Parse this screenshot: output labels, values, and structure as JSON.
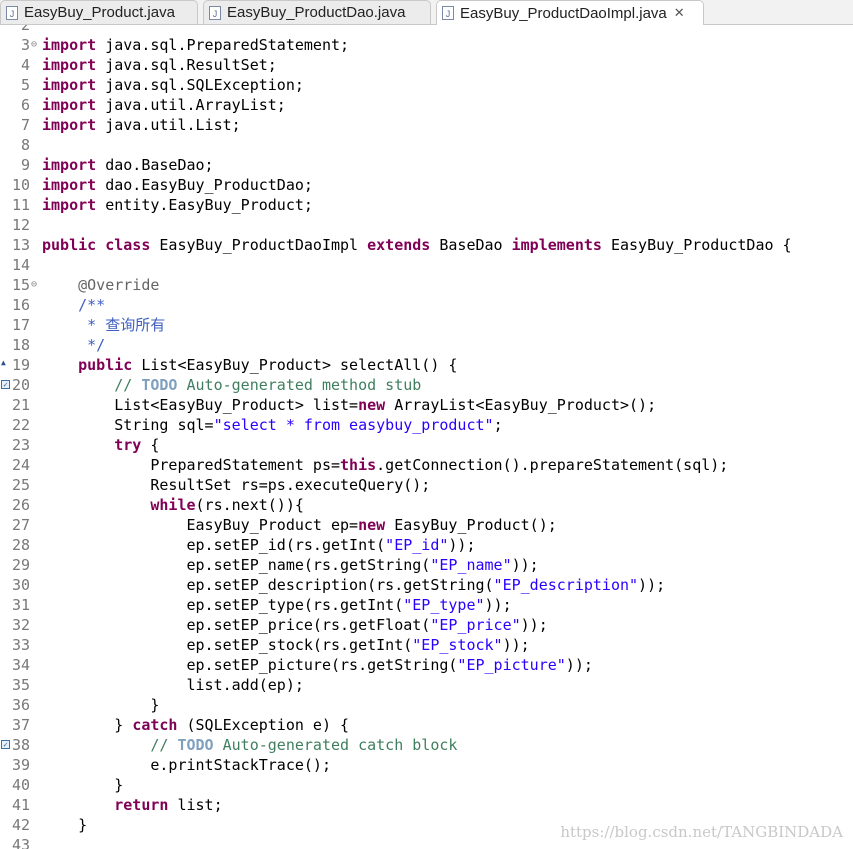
{
  "tabs": [
    {
      "label": "EasyBuy_Product.java",
      "active": false
    },
    {
      "label": "EasyBuy_ProductDao.java",
      "active": false
    },
    {
      "label": "EasyBuy_ProductDaoImpl.java",
      "active": true,
      "close": "✕"
    }
  ],
  "colors": {
    "keyword": "#7f0055",
    "string": "#2a00ff",
    "comment": "#3f7f5f",
    "javadoc": "#3f5fbf",
    "annotation": "#646464",
    "todo": "#7f9fbf"
  },
  "editor": {
    "lines": [
      {
        "n": "2",
        "tokens": []
      },
      {
        "n": "3",
        "fold": "⊖",
        "tokens": [
          {
            "t": "import",
            "k": "kw"
          },
          {
            "t": " java.sql.PreparedStatement;"
          }
        ]
      },
      {
        "n": "4",
        "tokens": [
          {
            "t": "import",
            "k": "kw"
          },
          {
            "t": " java.sql.ResultSet;"
          }
        ]
      },
      {
        "n": "5",
        "tokens": [
          {
            "t": "import",
            "k": "kw"
          },
          {
            "t": " java.sql.SQLException;"
          }
        ]
      },
      {
        "n": "6",
        "tokens": [
          {
            "t": "import",
            "k": "kw"
          },
          {
            "t": " java.util.ArrayList;"
          }
        ]
      },
      {
        "n": "7",
        "tokens": [
          {
            "t": "import",
            "k": "kw"
          },
          {
            "t": " java.util.List;"
          }
        ]
      },
      {
        "n": "8",
        "tokens": []
      },
      {
        "n": "9",
        "tokens": [
          {
            "t": "import",
            "k": "kw"
          },
          {
            "t": " dao.BaseDao;"
          }
        ]
      },
      {
        "n": "10",
        "tokens": [
          {
            "t": "import",
            "k": "kw"
          },
          {
            "t": " dao.EasyBuy_ProductDao;"
          }
        ]
      },
      {
        "n": "11",
        "tokens": [
          {
            "t": "import",
            "k": "kw"
          },
          {
            "t": " entity.EasyBuy_Product;"
          }
        ]
      },
      {
        "n": "12",
        "tokens": []
      },
      {
        "n": "13",
        "tokens": [
          {
            "t": "public",
            "k": "kw"
          },
          {
            "t": " "
          },
          {
            "t": "class",
            "k": "kw"
          },
          {
            "t": " EasyBuy_ProductDaoImpl "
          },
          {
            "t": "extends",
            "k": "kw"
          },
          {
            "t": " BaseDao "
          },
          {
            "t": "implements",
            "k": "kw"
          },
          {
            "t": " EasyBuy_ProductDao {"
          }
        ]
      },
      {
        "n": "14",
        "tokens": []
      },
      {
        "n": "15",
        "fold": "⊖",
        "tokens": [
          {
            "t": "    "
          },
          {
            "t": "@Override",
            "k": "ann"
          }
        ]
      },
      {
        "n": "16",
        "tokens": [
          {
            "t": "    "
          },
          {
            "t": "/**",
            "k": "doc"
          }
        ]
      },
      {
        "n": "17",
        "tokens": [
          {
            "t": "     "
          },
          {
            "t": "* 查询所有",
            "k": "doc"
          }
        ]
      },
      {
        "n": "18",
        "tokens": [
          {
            "t": "     "
          },
          {
            "t": "*/",
            "k": "doc"
          }
        ]
      },
      {
        "n": "19",
        "marker": "override",
        "tokens": [
          {
            "t": "    "
          },
          {
            "t": "public",
            "k": "kw"
          },
          {
            "t": " List<EasyBuy_Product> selectAll() {"
          }
        ]
      },
      {
        "n": "20",
        "marker": "task",
        "tokens": [
          {
            "t": "        "
          },
          {
            "t": "// ",
            "k": "cm"
          },
          {
            "t": "TODO",
            "k": "todo"
          },
          {
            "t": " Auto-generated method stub",
            "k": "cm"
          }
        ]
      },
      {
        "n": "21",
        "tokens": [
          {
            "t": "        List<EasyBuy_Product> list="
          },
          {
            "t": "new",
            "k": "kw"
          },
          {
            "t": " ArrayList<EasyBuy_Product>();"
          }
        ]
      },
      {
        "n": "22",
        "tokens": [
          {
            "t": "        String sql="
          },
          {
            "t": "\"select * from easybuy_product\"",
            "k": "str"
          },
          {
            "t": ";"
          }
        ]
      },
      {
        "n": "23",
        "tokens": [
          {
            "t": "        "
          },
          {
            "t": "try",
            "k": "kw"
          },
          {
            "t": " {"
          }
        ]
      },
      {
        "n": "24",
        "tokens": [
          {
            "t": "            PreparedStatement ps="
          },
          {
            "t": "this",
            "k": "kw"
          },
          {
            "t": ".getConnection().prepareStatement(sql);"
          }
        ]
      },
      {
        "n": "25",
        "tokens": [
          {
            "t": "            ResultSet rs=ps.executeQuery();"
          }
        ]
      },
      {
        "n": "26",
        "tokens": [
          {
            "t": "            "
          },
          {
            "t": "while",
            "k": "kw"
          },
          {
            "t": "(rs.next()){"
          }
        ]
      },
      {
        "n": "27",
        "tokens": [
          {
            "t": "                EasyBuy_Product ep="
          },
          {
            "t": "new",
            "k": "kw"
          },
          {
            "t": " EasyBuy_Product();"
          }
        ]
      },
      {
        "n": "28",
        "tokens": [
          {
            "t": "                ep.setEP_id(rs.getInt("
          },
          {
            "t": "\"EP_id\"",
            "k": "str"
          },
          {
            "t": "));"
          }
        ]
      },
      {
        "n": "29",
        "tokens": [
          {
            "t": "                ep.setEP_name(rs.getString("
          },
          {
            "t": "\"EP_name\"",
            "k": "str"
          },
          {
            "t": "));"
          }
        ]
      },
      {
        "n": "30",
        "tokens": [
          {
            "t": "                ep.setEP_description(rs.getString("
          },
          {
            "t": "\"EP_description\"",
            "k": "str"
          },
          {
            "t": "));"
          }
        ]
      },
      {
        "n": "31",
        "tokens": [
          {
            "t": "                ep.setEP_type(rs.getInt("
          },
          {
            "t": "\"EP_type\"",
            "k": "str"
          },
          {
            "t": "));"
          }
        ]
      },
      {
        "n": "32",
        "tokens": [
          {
            "t": "                ep.setEP_price(rs.getFloat("
          },
          {
            "t": "\"EP_price\"",
            "k": "str"
          },
          {
            "t": "));"
          }
        ]
      },
      {
        "n": "33",
        "tokens": [
          {
            "t": "                ep.setEP_stock(rs.getInt("
          },
          {
            "t": "\"EP_stock\"",
            "k": "str"
          },
          {
            "t": "));"
          }
        ]
      },
      {
        "n": "34",
        "tokens": [
          {
            "t": "                ep.setEP_picture(rs.getString("
          },
          {
            "t": "\"EP_picture\"",
            "k": "str"
          },
          {
            "t": "));"
          }
        ]
      },
      {
        "n": "35",
        "tokens": [
          {
            "t": "                list.add(ep);"
          }
        ]
      },
      {
        "n": "36",
        "tokens": [
          {
            "t": "            }"
          }
        ]
      },
      {
        "n": "37",
        "tokens": [
          {
            "t": "        } "
          },
          {
            "t": "catch",
            "k": "kw"
          },
          {
            "t": " (SQLException e) {"
          }
        ]
      },
      {
        "n": "38",
        "marker": "task",
        "tokens": [
          {
            "t": "            "
          },
          {
            "t": "// ",
            "k": "cm"
          },
          {
            "t": "TODO",
            "k": "todo"
          },
          {
            "t": " Auto-generated catch block",
            "k": "cm"
          }
        ]
      },
      {
        "n": "39",
        "tokens": [
          {
            "t": "            e.printStackTrace();"
          }
        ]
      },
      {
        "n": "40",
        "tokens": [
          {
            "t": "        }"
          }
        ]
      },
      {
        "n": "41",
        "tokens": [
          {
            "t": "        "
          },
          {
            "t": "return",
            "k": "kw"
          },
          {
            "t": " list;"
          }
        ]
      },
      {
        "n": "42",
        "tokens": [
          {
            "t": "    }"
          }
        ]
      },
      {
        "n": "43",
        "tokens": []
      }
    ]
  },
  "watermark": "https://blog.csdn.net/TANGBINDADA"
}
